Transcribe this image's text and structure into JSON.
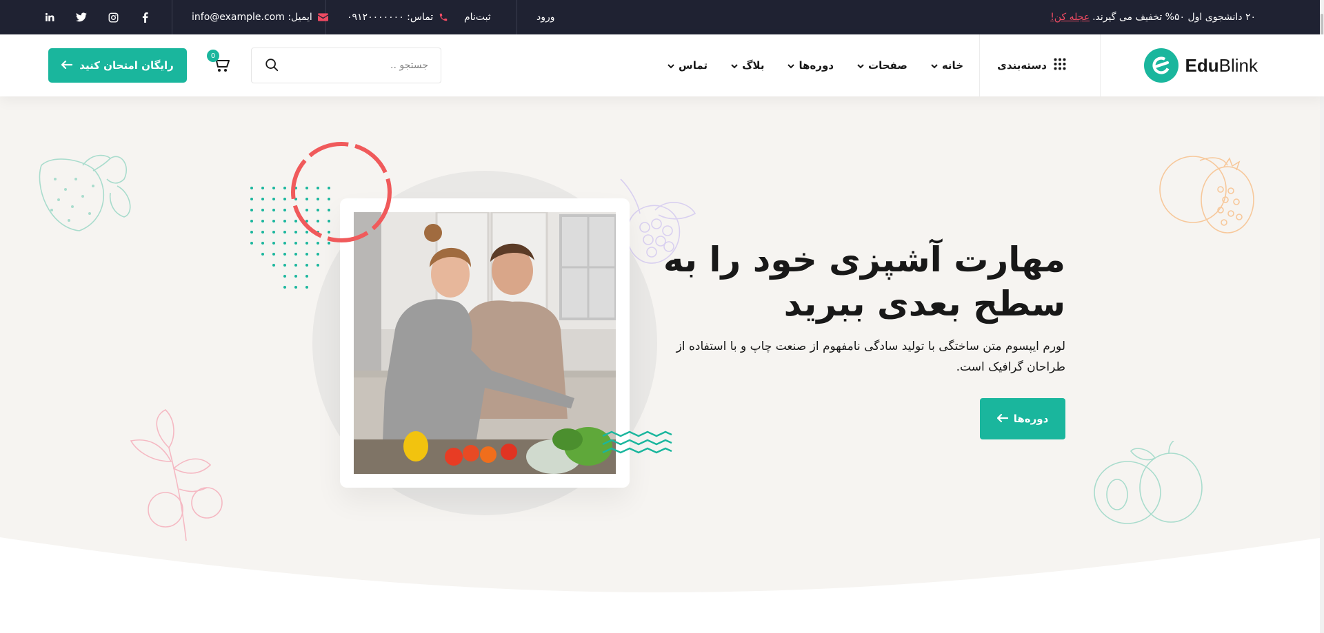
{
  "colors": {
    "accent": "#1ab69d",
    "pink": "#ee4a62",
    "topbar": "#1f2232",
    "hero_bg": "#f6f4f1"
  },
  "topbar": {
    "promo_text": "۲۰ دانشجوی اول ۵۰% تخفیف می گیرند.",
    "promo_link": "عجله کن!",
    "login": "ورود",
    "register": "ثبت‌نام",
    "phone": "تماس: ۰۹۱۲۰۰۰۰۰۰۰",
    "email": "ایمیل: info@example.com",
    "socials": [
      "facebook-icon",
      "instagram-icon",
      "twitter-icon",
      "linkedin-icon"
    ]
  },
  "header": {
    "logo_bold": "Edu",
    "logo_light": "Blink",
    "category": "دسته‌بندی",
    "nav": [
      {
        "label": "خانه"
      },
      {
        "label": "صفحات"
      },
      {
        "label": "دوره‌ها"
      },
      {
        "label": "بلاگ"
      },
      {
        "label": "تماس"
      }
    ],
    "search_placeholder": "جستجو ..",
    "cart_count": "0",
    "cta": "رایگان امتحان کنید"
  },
  "hero": {
    "title": "مهارت آشپزی خود را به سطح بعدی ببرید",
    "subtitle": "لورم ایپسوم متن ساختگی با تولید سادگی نامفهوم از صنعت چاپ و با استفاده از طراحان گرافیک است.",
    "button": "دوره‌ها"
  }
}
